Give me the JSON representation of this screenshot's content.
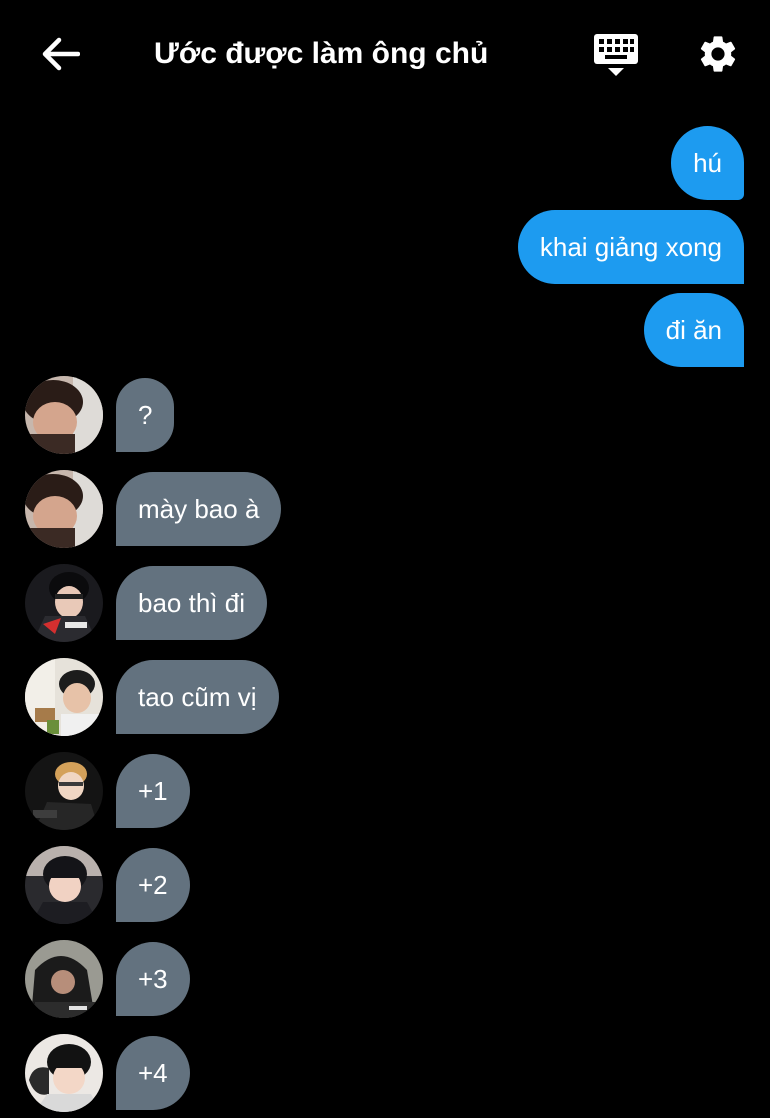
{
  "header": {
    "title": "Ước được làm ông chủ",
    "back_icon": "arrow-left-icon",
    "keyboard_icon": "keyboard-icon",
    "settings_icon": "gear-icon"
  },
  "colors": {
    "background": "#000000",
    "outgoing_bubble": "#1d9bf0",
    "incoming_bubble": "#63727f",
    "text": "#ffffff"
  },
  "outgoing": [
    {
      "text": "hú"
    },
    {
      "text": "khai giảng xong"
    },
    {
      "text": "đi ăn"
    }
  ],
  "incoming": [
    {
      "text": "?"
    },
    {
      "text": "mày bao à"
    },
    {
      "text": "bao thì đi"
    },
    {
      "text": "tao cũm vị"
    },
    {
      "text": "+1"
    },
    {
      "text": "+2"
    },
    {
      "text": "+3"
    },
    {
      "text": "+4"
    }
  ]
}
